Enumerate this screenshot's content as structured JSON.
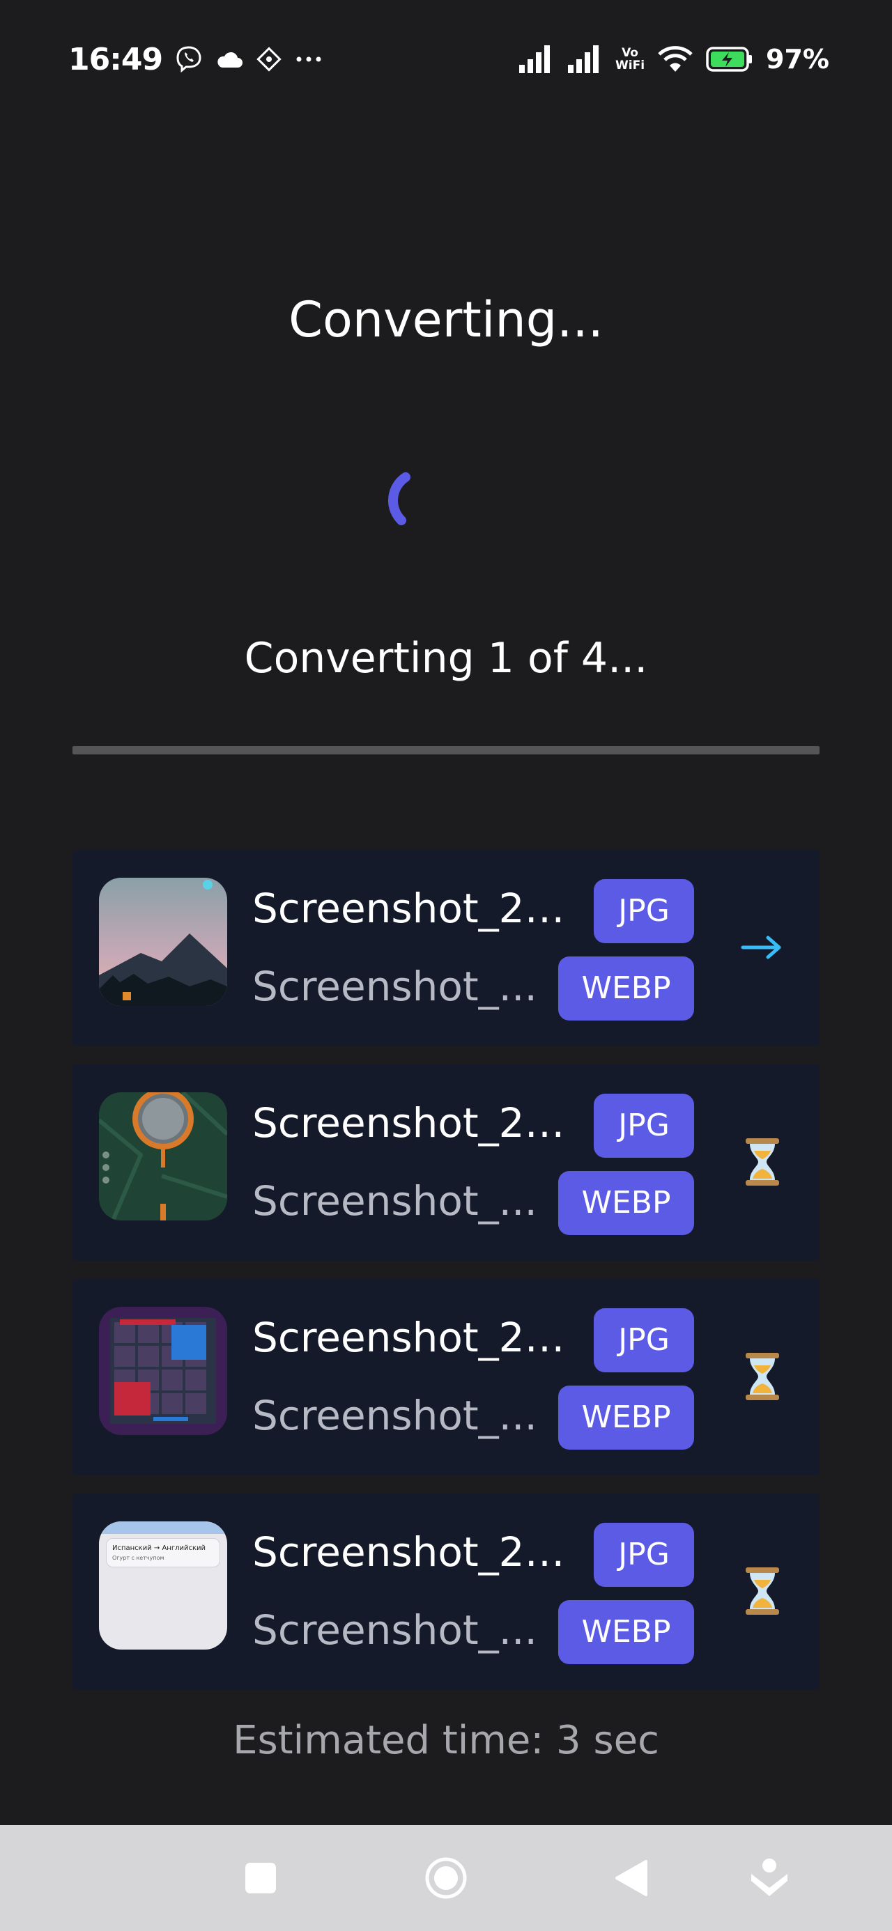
{
  "status_bar": {
    "time": "16:49",
    "vowifi_top": "Vo",
    "vowifi_bottom": "WiFi",
    "battery_percent": "97%",
    "icons": [
      "viber-icon",
      "cloud-icon",
      "diamond-app-icon",
      "more-dots-icon",
      "signal-icon",
      "signal-icon",
      "vowifi-icon",
      "wifi-icon",
      "battery-charging-icon"
    ]
  },
  "header": {
    "title": "Converting..."
  },
  "progress": {
    "text": "Converting 1 of 4...",
    "fraction": 0
  },
  "files": [
    {
      "name": "Screenshot_20...",
      "output_name": "Screenshot_...",
      "from_format": "JPG",
      "to_format": "WEBP",
      "status": "arrow-right-icon",
      "status_glyph": "→"
    },
    {
      "name": "Screenshot_20...",
      "output_name": "Screenshot_...",
      "from_format": "JPG",
      "to_format": "WEBP",
      "status": "hourglass-icon",
      "status_glyph": "⏳"
    },
    {
      "name": "Screenshot_20...",
      "output_name": "Screenshot_...",
      "from_format": "JPG",
      "to_format": "WEBP",
      "status": "hourglass-icon",
      "status_glyph": "⏳"
    },
    {
      "name": "Screenshot_20...",
      "output_name": "Screenshot_...",
      "from_format": "JPG",
      "to_format": "WEBP",
      "status": "hourglass-icon",
      "status_glyph": "⏳"
    }
  ],
  "thumbnail_4_text": {
    "line1": "Испанский → Английский",
    "line2": "Огурт с кетчупом"
  },
  "footer": {
    "estimate": "Estimated time: 3 sec"
  },
  "colors": {
    "background": "#1c1c1e",
    "card": "#141a29",
    "accent": "#5b5be6",
    "arrow": "#38bdf8"
  }
}
